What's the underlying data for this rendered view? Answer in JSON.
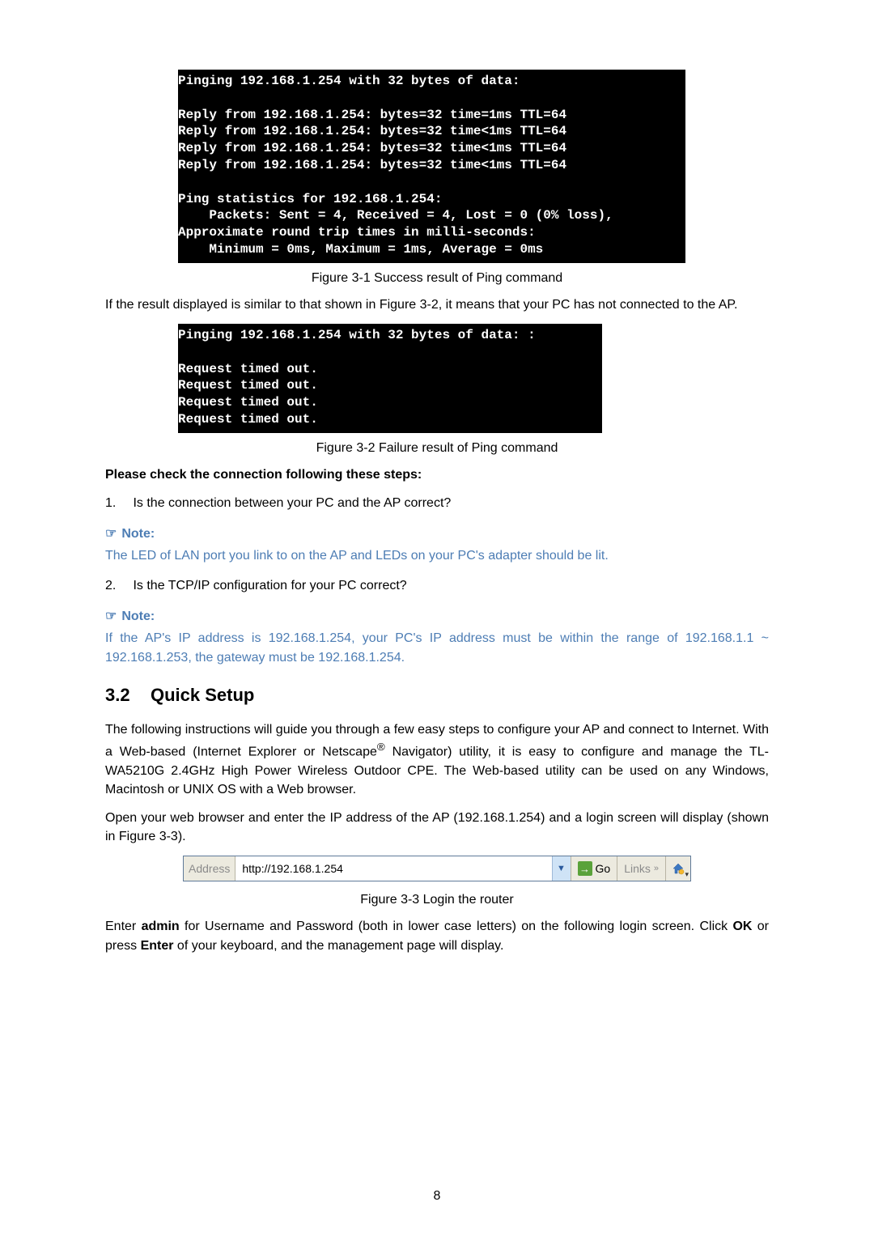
{
  "cmd1": "Pinging 192.168.1.254 with 32 bytes of data:\n\nReply from 192.168.1.254: bytes=32 time=1ms TTL=64\nReply from 192.168.1.254: bytes=32 time<1ms TTL=64\nReply from 192.168.1.254: bytes=32 time<1ms TTL=64\nReply from 192.168.1.254: bytes=32 time<1ms TTL=64\n\nPing statistics for 192.168.1.254:\n    Packets: Sent = 4, Received = 4, Lost = 0 (0% loss),\nApproximate round trip times in milli-seconds:\n    Minimum = 0ms, Maximum = 1ms, Average = 0ms",
  "fig1": "Figure 3-1 Success result of Ping command",
  "para1": "If the result displayed is similar to that shown in Figure 3-2, it means that your PC has not connected to the AP.",
  "cmd2": "Pinging 192.168.1.254 with 32 bytes of data: :\n\nRequest timed out.\nRequest timed out.\nRequest timed out.\nRequest timed out.",
  "fig2": "Figure 3-2 Failure result of Ping command",
  "checkline": "Please check the connection following these steps:",
  "item1": {
    "num": "1.",
    "text": "Is the connection between your PC and the AP correct?"
  },
  "noteLabel": "Note:",
  "note1": "The LED of LAN port you link to on the AP and LEDs on your PC's adapter should be lit.",
  "item2": {
    "num": "2.",
    "text": "Is the TCP/IP configuration for your PC correct?"
  },
  "note2": "If the AP's IP address is 192.168.1.254, your PC's IP address must be within the range of 192.168.1.1 ~ 192.168.1.253, the gateway must be 192.168.1.254.",
  "section": {
    "num": "3.2",
    "title": "Quick Setup"
  },
  "para2a": "The following instructions will guide you through a few easy steps to configure your AP and connect to Internet. With a Web-based (Internet Explorer or Netscape",
  "para2b": " Navigator) utility, it is easy to configure and manage the TL-WA5210G 2.4GHz High Power Wireless Outdoor CPE. The Web-based utility can be used on any Windows, Macintosh or UNIX OS with a Web browser.",
  "para3": "Open your web browser and enter the IP address of the AP (192.168.1.254) and a login screen will display (shown in Figure 3-3).",
  "addrbar": {
    "label": "Address",
    "url": "http://192.168.1.254",
    "go": "Go",
    "links": "Links"
  },
  "fig3": "Figure 3-3 Login the router",
  "para4a": "Enter ",
  "para4b": "admin",
  "para4c": " for Username and Password (both in lower case letters) on the following login screen. Click ",
  "para4d": "OK",
  "para4e": " or press ",
  "para4f": "Enter",
  "para4g": " of your keyboard, and the management page will display.",
  "pageNum": "8"
}
